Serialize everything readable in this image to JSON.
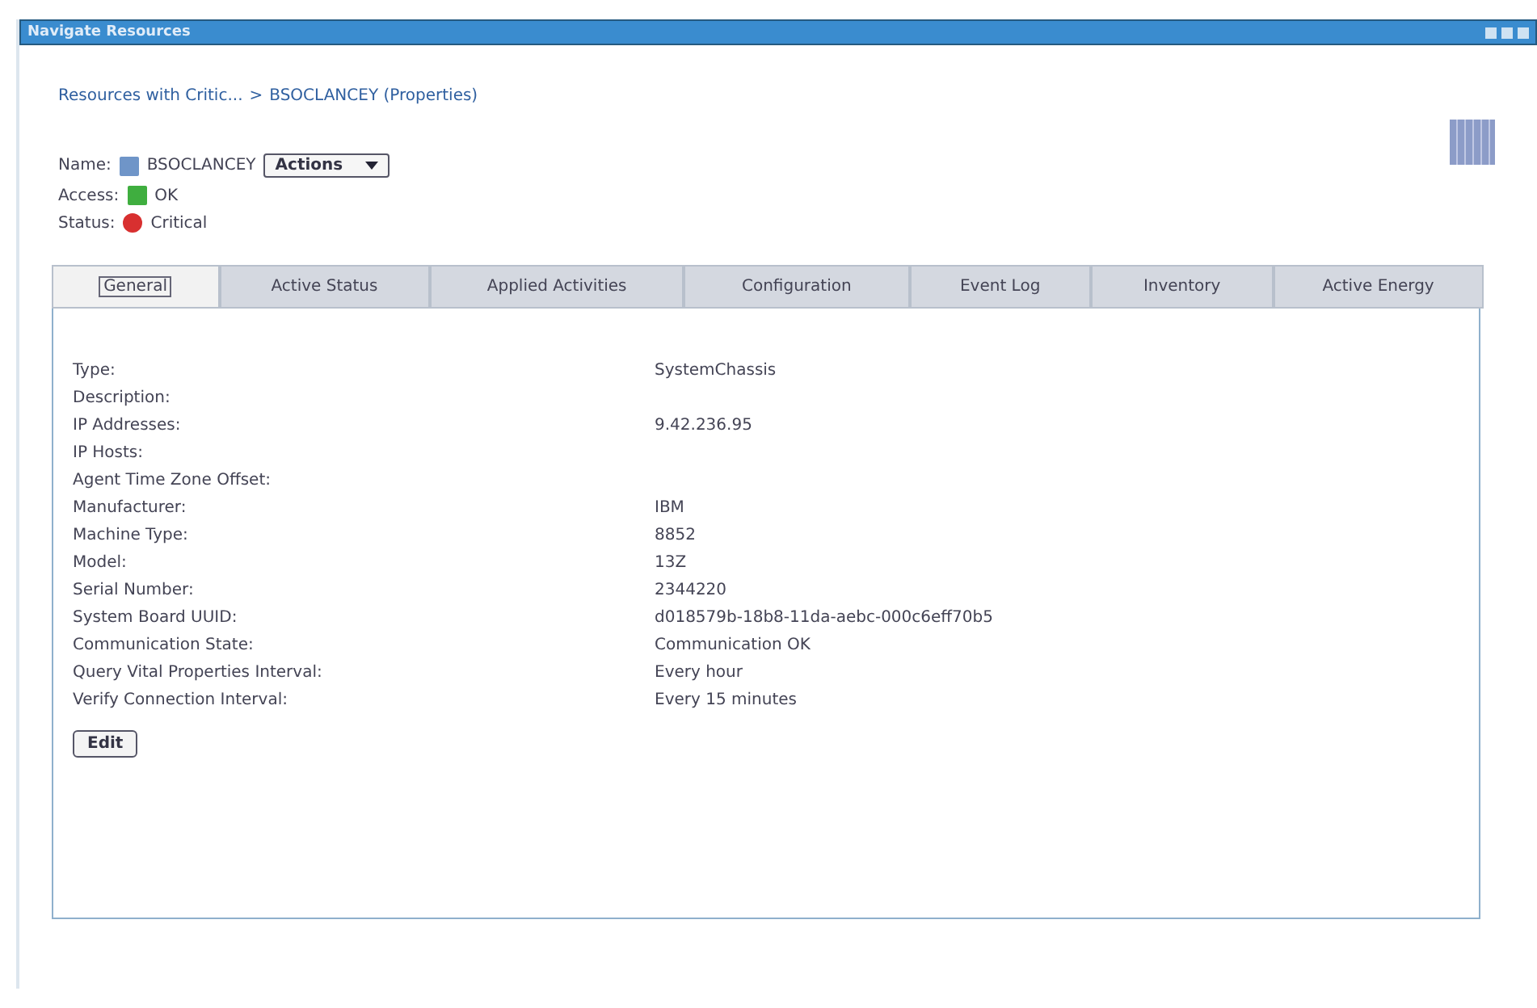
{
  "window": {
    "title": "Navigate Resources"
  },
  "breadcrumb": {
    "link": "Resources with Critic...",
    "separator": ">",
    "current": "BSOCLANCEY (Properties)"
  },
  "name": {
    "label": "Name:",
    "value": "BSOCLANCEY",
    "actions": "Actions"
  },
  "access": {
    "label": "Access:",
    "value": "OK",
    "color": "#3fae3f"
  },
  "status": {
    "label": "Status:",
    "value": "Critical",
    "color": "#d83030"
  },
  "tabs": [
    {
      "label": "General",
      "selected": true
    },
    {
      "label": "Active Status",
      "selected": false
    },
    {
      "label": "Applied Activities",
      "selected": false
    },
    {
      "label": "Configuration",
      "selected": false
    },
    {
      "label": "Event Log",
      "selected": false
    },
    {
      "label": "Inventory",
      "selected": false
    },
    {
      "label": "Active Energy",
      "selected": false
    }
  ],
  "properties": [
    {
      "label": "Type:",
      "value": "SystemChassis"
    },
    {
      "label": "Description:"
    },
    {
      "label": "IP Addresses:",
      "value": "9.42.236.95"
    },
    {
      "label": "IP Hosts:"
    },
    {
      "label": "Agent Time Zone Offset:"
    },
    {
      "label": "Manufacturer:",
      "value": "IBM"
    },
    {
      "label": "Machine Type:",
      "value": "8852"
    },
    {
      "label": "Model:",
      "value": "13Z"
    },
    {
      "label": "Serial Number:",
      "value": "2344220"
    },
    {
      "label": "System Board UUID:",
      "value": "d018579b-18b8-11da-aebc-000c6eff70b5"
    },
    {
      "label": "Communication State:",
      "value": "Communication OK"
    },
    {
      "label": "Query Vital Properties Interval:",
      "value": "Every hour"
    },
    {
      "label": "Verify Connection Interval:",
      "value": "Every 15 minutes"
    }
  ],
  "edit_button": "Edit"
}
